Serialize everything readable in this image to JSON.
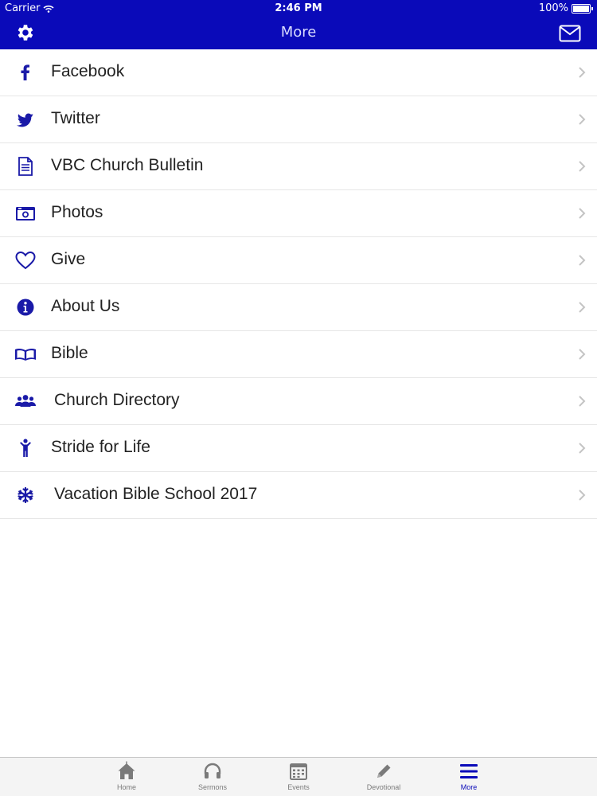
{
  "status_bar": {
    "carrier": "Carrier",
    "time": "2:46 PM",
    "battery": "100%"
  },
  "nav": {
    "title": "More",
    "left_icon": "gear-icon",
    "right_icon": "mail-icon"
  },
  "menu_items": [
    {
      "label": "Facebook",
      "icon": "facebook-icon"
    },
    {
      "label": "Twitter",
      "icon": "twitter-icon"
    },
    {
      "label": "VBC Church Bulletin",
      "icon": "document-icon"
    },
    {
      "label": "Photos",
      "icon": "camera-icon"
    },
    {
      "label": "Give",
      "icon": "heart-icon"
    },
    {
      "label": "About Us",
      "icon": "info-icon"
    },
    {
      "label": "Bible",
      "icon": "book-icon"
    },
    {
      "label": "Church Directory",
      "icon": "users-icon"
    },
    {
      "label": "Stride for Life",
      "icon": "person-icon"
    },
    {
      "label": "Vacation Bible School 2017",
      "icon": "snowflake-icon"
    }
  ],
  "tabs": [
    {
      "label": "Home",
      "icon": "home-icon",
      "active": false
    },
    {
      "label": "Sermons",
      "icon": "headphones-icon",
      "active": false
    },
    {
      "label": "Events",
      "icon": "calendar-icon",
      "active": false
    },
    {
      "label": "Devotional",
      "icon": "pencil-icon",
      "active": false
    },
    {
      "label": "More",
      "icon": "menu-icon",
      "active": true
    }
  ],
  "colors": {
    "brand": "#0a0ab9",
    "icon": "#1a1aa8",
    "tab_inactive": "#7a7a7a"
  }
}
